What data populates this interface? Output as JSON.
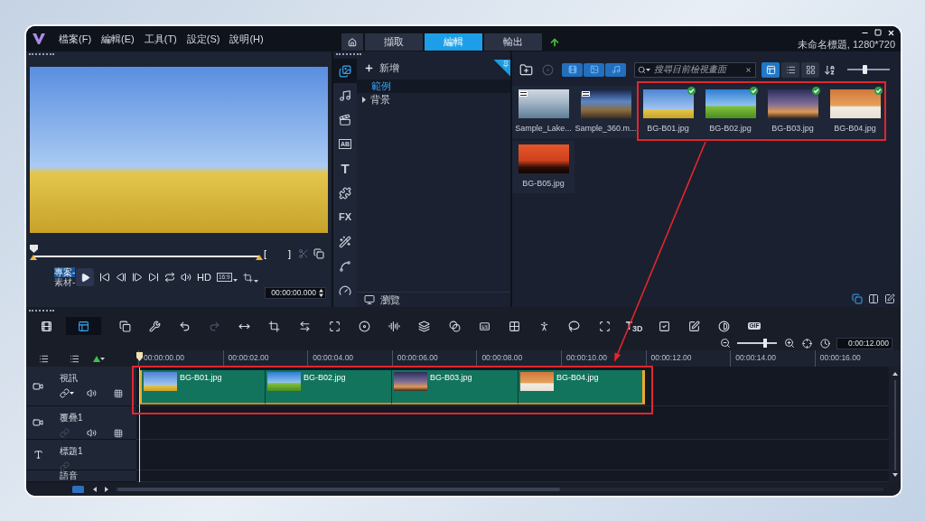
{
  "menu_bar": {
    "items": [
      "檔案(F)",
      "編輯(E)",
      "工具(T)",
      "設定(S)",
      "說明(H)"
    ]
  },
  "mode_tabs": [
    {
      "label": "擷取",
      "selected": false
    },
    {
      "label": "編輯",
      "selected": true
    },
    {
      "label": "輸出",
      "selected": false
    }
  ],
  "window": {
    "title": "未命名標題, 1280*720"
  },
  "preview": {
    "scrubber": {
      "level": 0
    },
    "mark_in": "[",
    "mark_out": "]",
    "modes": [
      {
        "label": "專案-",
        "selected": true
      },
      {
        "label": "素材-",
        "selected": false
      }
    ],
    "quality": "HD",
    "aspect": "16:9",
    "timecode": "00:00:00.000"
  },
  "library_nav": {
    "categories": [
      {
        "kind": "media",
        "selected": true
      },
      {
        "kind": "audio",
        "selected": false
      },
      {
        "kind": "template",
        "selected": false
      },
      {
        "kind": "transition",
        "glyph": "AB",
        "selected": false
      },
      {
        "kind": "title",
        "glyph": "T",
        "selected": false
      },
      {
        "kind": "graphics",
        "selected": false
      },
      {
        "kind": "filter",
        "glyph": "FX",
        "selected": false
      },
      {
        "kind": "effects",
        "selected": false
      },
      {
        "kind": "path",
        "selected": false
      },
      {
        "kind": "speed",
        "selected": false
      }
    ],
    "add_label": "新增",
    "folders": [
      {
        "label": "範例",
        "kind": "item",
        "selected": true
      },
      {
        "label": "背景",
        "kind": "group",
        "selected": false
      }
    ],
    "browse_label": "瀏覽"
  },
  "library": {
    "filters": [
      {
        "kind": "video",
        "selected": true
      },
      {
        "kind": "photo",
        "selected": true
      },
      {
        "kind": "audio",
        "selected": true
      }
    ],
    "search": {
      "placeholder": "搜尋目前檢視畫面"
    },
    "views": [
      {
        "kind": "thumbnail",
        "selected": true
      },
      {
        "kind": "list",
        "selected": false
      },
      {
        "kind": "grid",
        "selected": false
      }
    ],
    "size_slider": {
      "level": 0.4
    },
    "items": [
      {
        "name": "Sample_Lake...",
        "kind": "video",
        "checked": false
      },
      {
        "name": "Sample_360.m...",
        "kind": "video",
        "checked": false
      },
      {
        "name": "BG-B01.jpg",
        "kind": "photo",
        "checked": true
      },
      {
        "name": "BG-B02.jpg",
        "kind": "photo",
        "checked": true
      },
      {
        "name": "BG-B03.jpg",
        "kind": "photo",
        "checked": true
      },
      {
        "name": "BG-B04.jpg",
        "kind": "photo",
        "checked": true
      },
      {
        "name": "BG-B05.jpg",
        "kind": "photo",
        "checked": false
      }
    ]
  },
  "timeline": {
    "views": [
      {
        "kind": "storyboard",
        "selected": false
      },
      {
        "kind": "timeline",
        "selected": true
      }
    ],
    "tools": [
      {
        "kind": "record",
        "disabled": false
      },
      {
        "kind": "tools",
        "disabled": false
      },
      {
        "kind": "undo",
        "disabled": false
      },
      {
        "kind": "redo",
        "disabled": true
      },
      {
        "kind": "fit",
        "disabled": false
      },
      {
        "kind": "export",
        "disabled": false
      },
      {
        "kind": "split",
        "disabled": false
      },
      {
        "kind": "resize",
        "disabled": false
      },
      {
        "kind": "audio_record",
        "disabled": false
      },
      {
        "kind": "audio",
        "disabled": false
      },
      {
        "kind": "mask",
        "disabled": false
      },
      {
        "kind": "blend",
        "disabled": false
      },
      {
        "kind": "title",
        "disabled": false
      },
      {
        "kind": "split_screen",
        "disabled": false
      },
      {
        "kind": "motion",
        "disabled": false
      },
      {
        "kind": "lasso",
        "disabled": false
      },
      {
        "kind": "frame",
        "disabled": false
      },
      {
        "kind": "title3d",
        "glyph": "T$_{3D}$",
        "disabled": false
      },
      {
        "kind": "check",
        "disabled": false
      },
      {
        "kind": "edit",
        "disabled": false
      },
      {
        "kind": "color",
        "disabled": false
      },
      {
        "kind": "gif",
        "glyph": "GIF",
        "disabled": false
      }
    ],
    "zoom": {
      "level": 0.7
    },
    "duration": "0:00:12.000",
    "ruler": [
      "00:00:00.00",
      "00:00:02.00",
      "00:00:04.00",
      "00:00:06.00",
      "00:00:08.00",
      "00:00:10.00",
      "00:00:12.00",
      "00:00:14.00",
      "00:00:16.00"
    ],
    "tracks": [
      {
        "label": "視訊",
        "kind": "video",
        "clips": [
          {
            "label": "BG-B01.jpg"
          },
          {
            "label": "BG-B02.jpg"
          },
          {
            "label": "BG-B03.jpg"
          },
          {
            "label": "BG-B04.jpg"
          }
        ]
      },
      {
        "label": "覆疊1",
        "kind": "overlay"
      },
      {
        "label": "標題1",
        "kind": "title"
      },
      {
        "label": "語音",
        "kind": "voice"
      }
    ]
  }
}
